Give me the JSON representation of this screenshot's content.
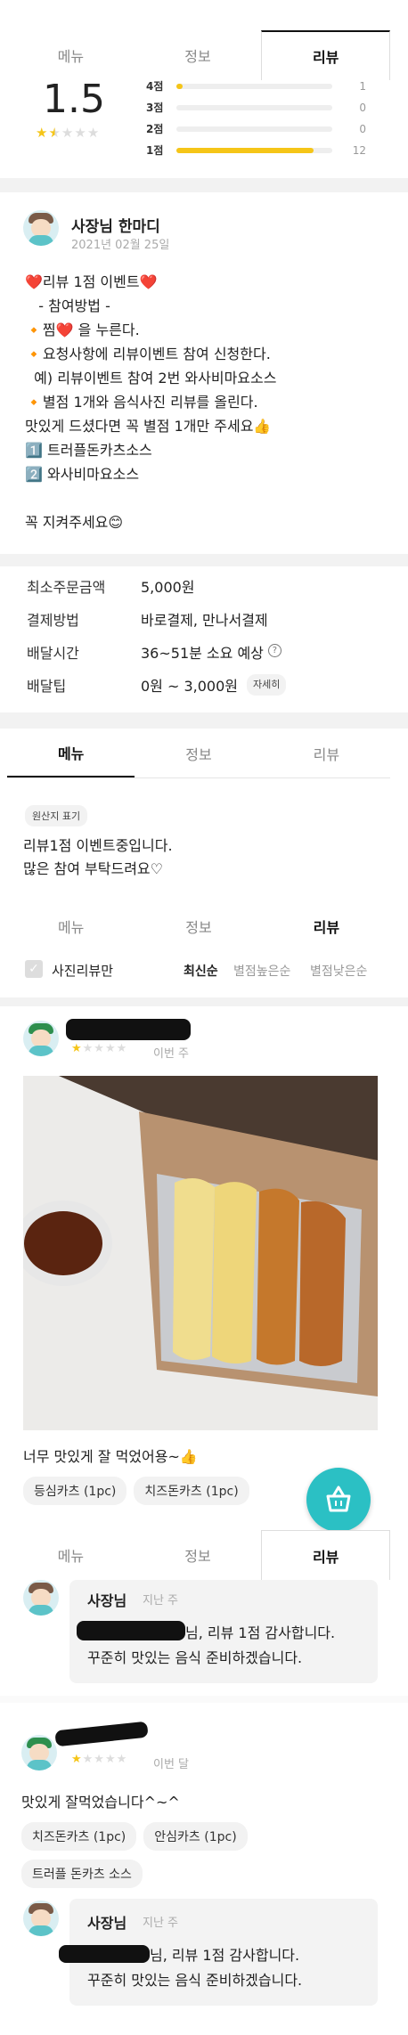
{
  "tabs_top": {
    "menu": "메뉴",
    "info": "정보",
    "review": "리뷰"
  },
  "rating_summary": {
    "score": "1.5",
    "bars": [
      {
        "label": "4점",
        "count": "1",
        "fraction": 0.04
      },
      {
        "label": "3점",
        "count": "0",
        "fraction": 0
      },
      {
        "label": "2점",
        "count": "0",
        "fraction": 0
      },
      {
        "label": "1점",
        "count": "12",
        "fraction": 0.88
      }
    ],
    "stars_filled": 1.5
  },
  "owner_notice": {
    "title": "사장님 한마디",
    "date": "2021년 02월 25일",
    "lines": [
      "❤️리뷰 1점 이벤트❤️",
      "   - 참여방법 -",
      "🔸찜❤️ 을 누른다.",
      "🔸요청사항에 리뷰이벤트 참여 신청한다.",
      "  예) 리뷰이벤트 참여 2번 와사비마요소스",
      "🔸별점 1개와 음식사진 리뷰를 올린다.",
      "맛있게 드셨다면 꼭 별점 1개만 주세요👍",
      "1️⃣ 트러플돈카츠소스",
      "2️⃣ 와사비마요소스",
      "",
      "꼭 지켜주세요😊"
    ]
  },
  "delivery_info": {
    "min_order_label": "최소주문금액",
    "min_order_value": "5,000원",
    "payment_label": "결제방법",
    "payment_value": "바로결제, 만나서결제",
    "time_label": "배달시간",
    "time_value": "36~51분 소요 예상",
    "tip_label": "배달팁",
    "tip_value": "0원 ~ 3,000원",
    "tip_detail": "자세히"
  },
  "tabs_mid": {
    "menu": "메뉴",
    "info": "정보",
    "review": "리뷰"
  },
  "menu_notice": {
    "origin_badge": "원산지 표기",
    "line1": "리뷰1점 이벤트중입니다.",
    "line2": "많은 참여 부탁드려요♡"
  },
  "tabs_review": {
    "menu": "메뉴",
    "info": "정보",
    "review": "리뷰"
  },
  "review_filters": {
    "photo_only": "사진리뷰만",
    "sort_latest": "최신순",
    "sort_high": "별점높은순",
    "sort_low": "별점낮은순"
  },
  "review1": {
    "time": "이번 주",
    "stars": 1,
    "text": "너무 맛있게 잘 먹었어용~👍",
    "chips": [
      "등심카츠 (1pc)",
      "치즈돈카츠 (1pc)"
    ]
  },
  "tabs_bottom": {
    "menu": "메뉴",
    "info": "정보",
    "review": "리뷰"
  },
  "reply1": {
    "author": "사장님",
    "time": "지난 주",
    "line1": "님, 리뷰 1점 감사합니다.",
    "line2": "꾸준히 맛있는 음식 준비하겠습니다."
  },
  "review2": {
    "time": "이번 달",
    "stars": 1,
    "text": "맛있게 잘먹었습니다^~^",
    "chips": [
      "치즈돈카츠 (1pc)",
      "안심카츠 (1pc)",
      "트러플 돈카츠 소스"
    ]
  },
  "reply2": {
    "author": "사장님",
    "time": "지난 주",
    "line1": "님, 리뷰 1점 감사합니다.",
    "line2": "꾸준히 맛있는 음식 준비하겠습니다."
  },
  "colors": {
    "accent_teal": "#2bc0c4",
    "star": "#f5c518"
  }
}
